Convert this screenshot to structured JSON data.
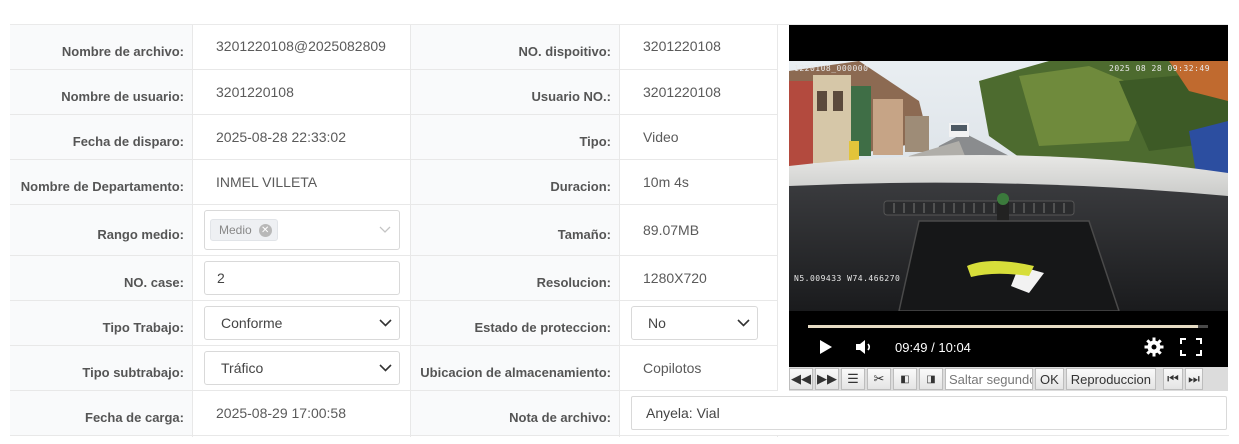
{
  "left_labels": [
    "Nombre de archivo:",
    "Nombre de usuario:",
    "Fecha de disparo:",
    "Nombre de Departamento:",
    "Rango medio:",
    "NO. case:",
    "Tipo Trabajo:",
    "Tipo subtrabajo:",
    "Fecha de carga:"
  ],
  "left_values": {
    "nombre_archivo": "3201220108@2025082809",
    "nombre_usuario": "3201220108",
    "fecha_disparo": "2025-08-28 22:33:02",
    "departamento": "INMEL VILLETA",
    "rango_tag": "Medio",
    "no_case": "2",
    "tipo_trabajo": "Conforme",
    "tipo_subtrabajo": "Tráfico",
    "fecha_carga": "2025-08-29 17:00:58"
  },
  "mid_labels": [
    "NO. dispoitivo:",
    "Usuario NO.:",
    "Tipo:",
    "Duracion:",
    "Tamaño:",
    "Resolucion:",
    "Estado de proteccion:",
    "Ubicacion de almacenamiento:",
    "Nota de archivo:"
  ],
  "mid_values": {
    "dispositivo": "3201220108",
    "usuario_no": "3201220108",
    "tipo": "Video",
    "duracion": "10m 4s",
    "tamano": "89.07MB",
    "resolucion": "1280X720",
    "estado_proteccion": "No",
    "ubicacion": "Copilotos",
    "nota": "Anyela: Vial"
  },
  "video": {
    "overlay_id": "1220108_000000",
    "overlay_time": "2025 08 28 09:32:49",
    "overlay_gps": "N5.009433  W74.466270",
    "time_display": "09:49 / 10:04",
    "progress": 0.975
  },
  "toolbar": {
    "seek_placeholder": "Saltar segundos",
    "ok_label": "OK",
    "play_label": "Reproduccion"
  },
  "colors": {
    "label_bg": "#f9fafb",
    "border": "#e8e8e8",
    "progress": "#e6dcc4"
  }
}
